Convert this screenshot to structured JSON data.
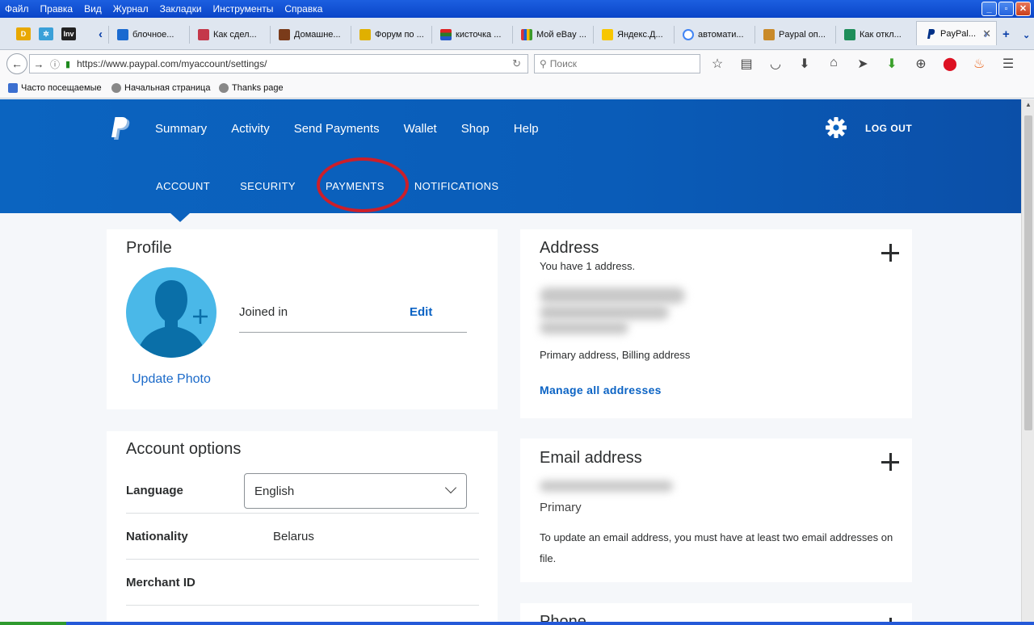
{
  "window": {
    "menu": [
      "Файл",
      "Правка",
      "Вид",
      "Журнал",
      "Закладки",
      "Инструменты",
      "Справка"
    ]
  },
  "tabs": [
    {
      "label": "блочное...",
      "icon": "tab-favicon-arrow",
      "color": "#1a6ad0"
    },
    {
      "label": "Как сдел...",
      "icon": "tab-favicon-ufo",
      "color": "#c4384a"
    },
    {
      "label": "Домашне...",
      "icon": "tab-favicon-home",
      "color": "#7a3b1a"
    },
    {
      "label": "Форум по ...",
      "icon": "tab-favicon-speaker",
      "color": "#e0b000"
    },
    {
      "label": "кисточка ...",
      "icon": "tab-favicon-stripes",
      "color": "#2a7a2a"
    },
    {
      "label": "Мой eBay ...",
      "icon": "tab-favicon-ebay",
      "color": "#d33"
    },
    {
      "label": "Яндекс.Д...",
      "icon": "tab-favicon-yandex",
      "color": "#f7c600"
    },
    {
      "label": "автомати...",
      "icon": "tab-favicon-google",
      "color": "#4285f4"
    },
    {
      "label": "Paypal оп...",
      "icon": "tab-favicon-box",
      "color": "#c98a2a"
    },
    {
      "label": "Как откл...",
      "icon": "tab-favicon-e",
      "color": "#1e8e5a"
    }
  ],
  "active_tab": {
    "label": "PayPal...",
    "icon": "paypal-favicon"
  },
  "urlbar": {
    "url": "https://www.paypal.com/myaccount/settings/"
  },
  "search": {
    "placeholder": "Поиск"
  },
  "bookmarks": [
    "Часто посещаемые",
    "Начальная страница",
    "Thanks page"
  ],
  "nav": {
    "items": [
      "Summary",
      "Activity",
      "Send Payments",
      "Wallet",
      "Shop",
      "Help"
    ],
    "logout": "LOG OUT"
  },
  "subnav": {
    "items": [
      "ACCOUNT",
      "SECURITY",
      "PAYMENTS",
      "NOTIFICATIONS"
    ],
    "active": "ACCOUNT",
    "highlighted": "PAYMENTS"
  },
  "profile": {
    "title": "Profile",
    "update_photo": "Update Photo",
    "joined_label": "Joined in",
    "edit": "Edit"
  },
  "account_options": {
    "title": "Account options",
    "language_label": "Language",
    "language_value": "English",
    "nationality_label": "Nationality",
    "nationality_value": "Belarus",
    "merchant_label": "Merchant ID"
  },
  "address": {
    "title": "Address",
    "count": "You have 1 address.",
    "type": "Primary address, Billing address",
    "manage": "Manage all addresses"
  },
  "email": {
    "title": "Email address",
    "primary": "Primary",
    "note": "To update an email address, you must have at least two email addresses on file."
  },
  "phone": {
    "title": "Phone"
  },
  "colors": {
    "brand_blue": "#0b64c0",
    "link": "#0b63c4",
    "highlight_ring": "#cc1f2a"
  }
}
